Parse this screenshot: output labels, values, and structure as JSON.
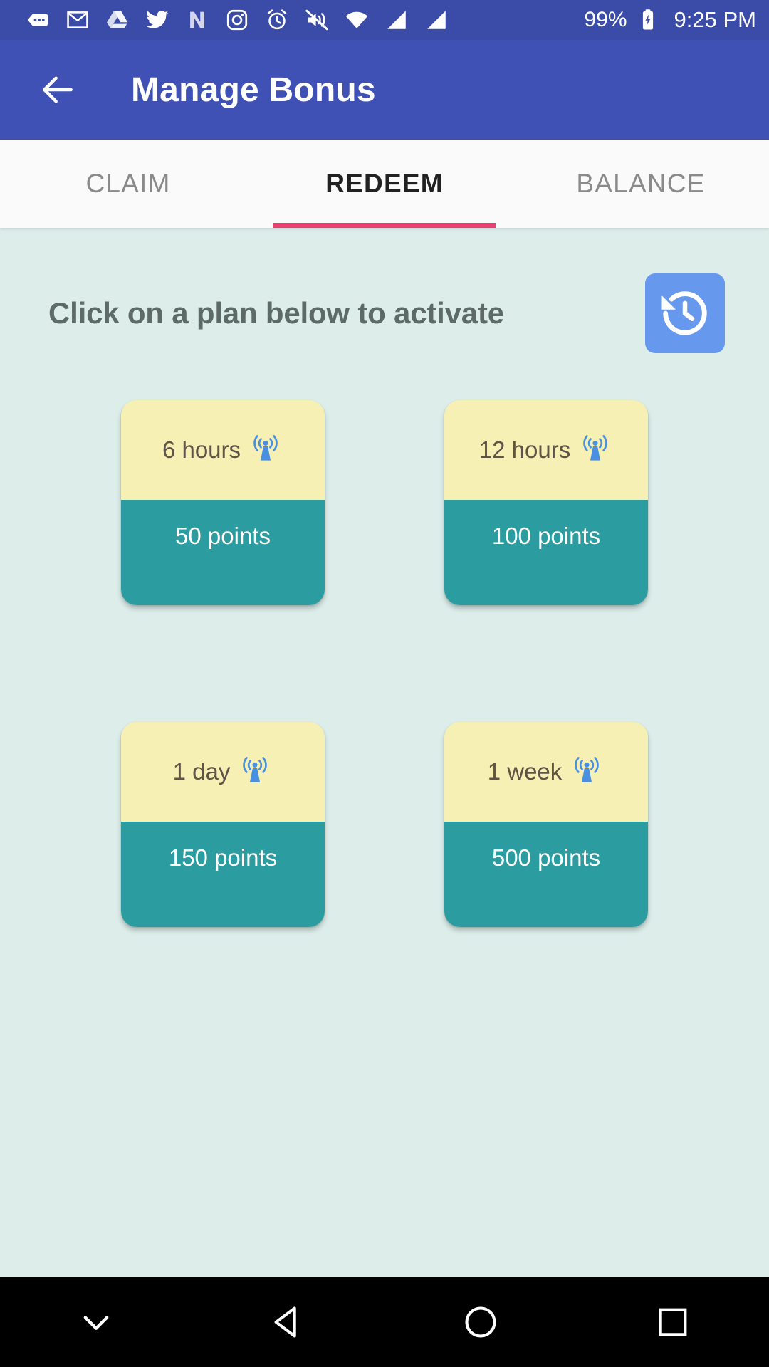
{
  "status_bar": {
    "icons": [
      {
        "name": "messages-dots-icon"
      },
      {
        "name": "gmail-icon"
      },
      {
        "name": "google-drive-icon"
      },
      {
        "name": "twitter-icon"
      },
      {
        "name": "nova-launcher-icon"
      },
      {
        "name": "instagram-icon"
      },
      {
        "name": "alarm-clock-icon"
      },
      {
        "name": "volume-mute-icon"
      },
      {
        "name": "wifi-icon"
      },
      {
        "name": "signal-sim1-icon"
      },
      {
        "name": "signal-sim2-icon"
      }
    ],
    "battery_percent": "99%",
    "battery_icon": "battery-charging-icon",
    "time": "9:25 PM",
    "background_color": "#3B4BA8"
  },
  "app_bar": {
    "back_icon": "arrow-back-icon",
    "title": "Manage Bonus",
    "background_color": "#3F51B5"
  },
  "tabs": {
    "items": [
      {
        "label": "CLAIM",
        "active": false
      },
      {
        "label": "REDEEM",
        "active": true
      },
      {
        "label": "BALANCE",
        "active": false
      }
    ],
    "indicator_color": "#EC3E6E"
  },
  "content": {
    "background_color": "#DCEDEA",
    "heading": "Click on a plan below to activate",
    "history_button": {
      "icon": "history-icon",
      "background_color": "#6699EE"
    },
    "plans": [
      {
        "duration": "6 hours",
        "points": "50 points",
        "icon": "wifi-tower-icon"
      },
      {
        "duration": "12 hours",
        "points": "100 points",
        "icon": "wifi-tower-icon"
      },
      {
        "duration": "1 day",
        "points": "150 points",
        "icon": "wifi-tower-icon"
      },
      {
        "duration": "1 week",
        "points": "500 points",
        "icon": "wifi-tower-icon"
      }
    ],
    "card_top_color": "#F7F0B4",
    "card_bottom_color": "#2B9CA0"
  },
  "nav_bar": {
    "buttons": [
      {
        "name": "nav-hide-keyboard",
        "icon": "chevron-down-icon"
      },
      {
        "name": "nav-back",
        "icon": "triangle-back-icon"
      },
      {
        "name": "nav-home",
        "icon": "circle-home-icon"
      },
      {
        "name": "nav-recents",
        "icon": "square-recents-icon"
      }
    ],
    "background_color": "#000000"
  }
}
